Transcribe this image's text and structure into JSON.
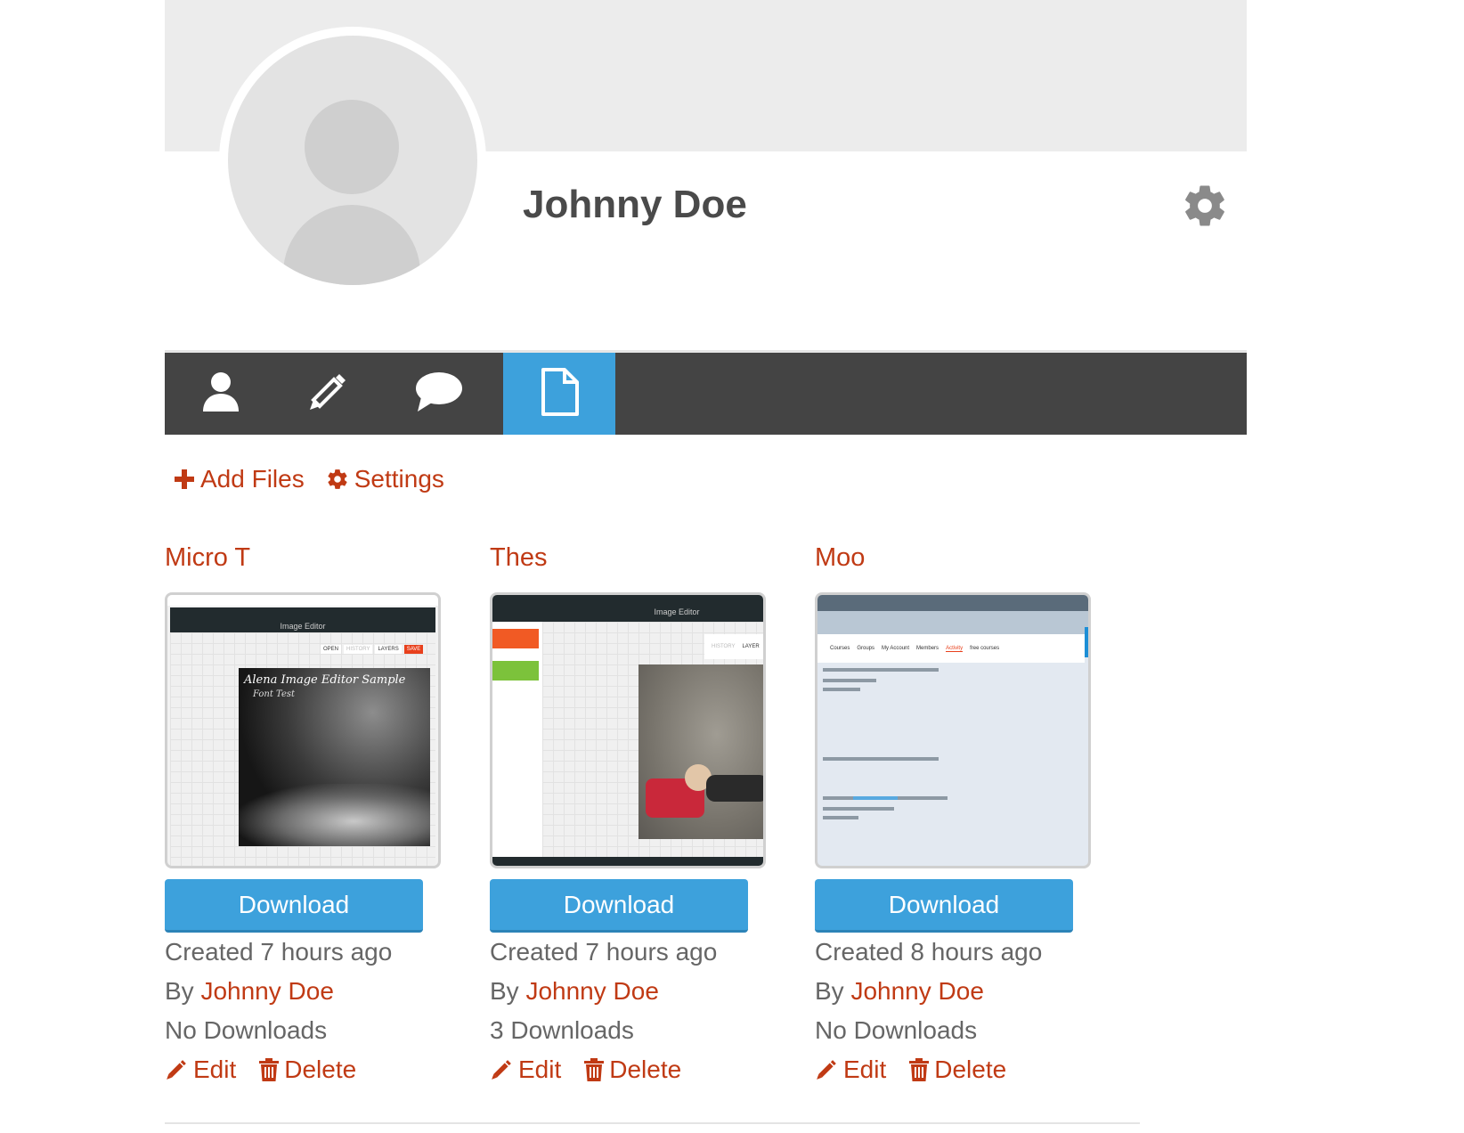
{
  "profile": {
    "name": "Johnny Doe"
  },
  "actions": {
    "add_files": "Add Files",
    "settings": "Settings"
  },
  "files": [
    {
      "title": "Micro T",
      "download": "Download",
      "created": "Created 7 hours ago",
      "by_prefix": "By ",
      "author": "Johnny Doe",
      "downloads": "No Downloads",
      "edit": "Edit",
      "delete": "Delete",
      "thumb_title": "Image Editor",
      "thumb_caption": "Alena Image Editor Sample",
      "thumb_sub": "Font Test",
      "thumb_btns": [
        "OPEN",
        "HISTORY",
        "LAYERS",
        "SAVE"
      ]
    },
    {
      "title": "Thes",
      "download": "Download",
      "created": "Created 7 hours ago",
      "by_prefix": "By ",
      "author": "Johnny Doe",
      "downloads": "3 Downloads",
      "edit": "Edit",
      "delete": "Delete",
      "thumb_title": "Image Editor",
      "thumb_btns": [
        "HISTORY",
        "LAYER"
      ]
    },
    {
      "title": "Moo",
      "download": "Download",
      "created": "Created 8 hours ago",
      "by_prefix": "By ",
      "author": "Johnny Doe",
      "downloads": "No Downloads",
      "edit": "Edit",
      "delete": "Delete",
      "thumb_nav": [
        "Courses",
        "Groups",
        "My Account",
        "Members",
        "Activity",
        "free courses"
      ]
    }
  ],
  "colors": {
    "accent": "#c03a14",
    "primary": "#3da1dc",
    "navbar": "#444444",
    "cover": "#ececec"
  },
  "icons": {
    "nav": [
      "user-icon",
      "pencil-icon",
      "chat-icon",
      "file-icon"
    ]
  }
}
